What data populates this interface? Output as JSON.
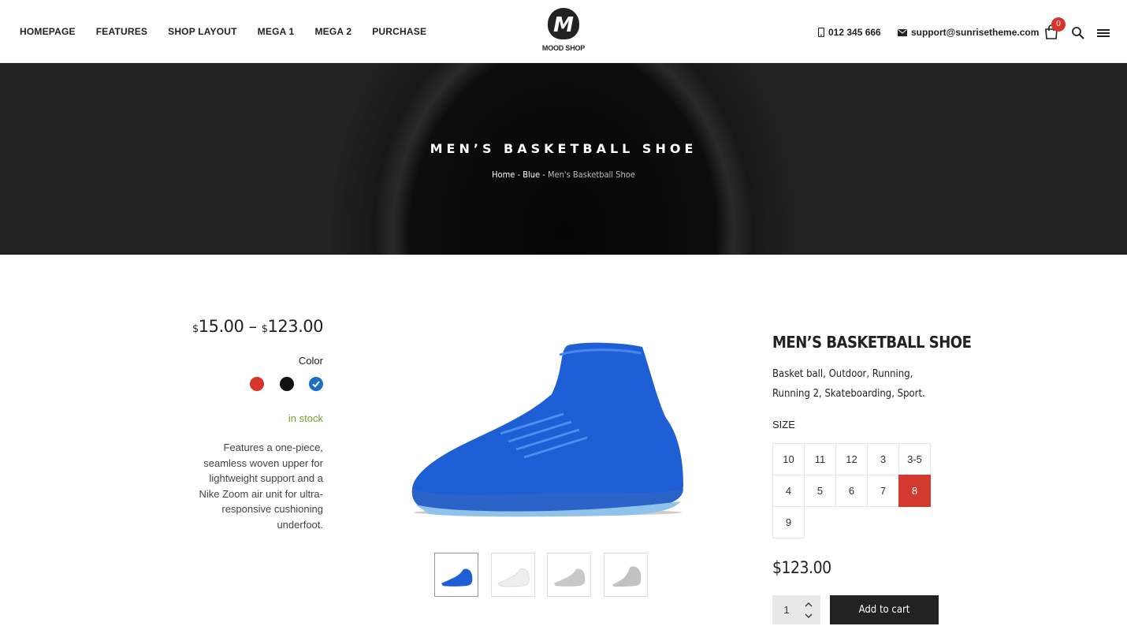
{
  "nav": {
    "items": [
      "HOMEPAGE",
      "FEATURES",
      "SHOP LAYOUT",
      "MEGA 1",
      "MEGA 2",
      "PURCHASE"
    ]
  },
  "logo": {
    "letter": "M",
    "name": "MOOD SHOP"
  },
  "header": {
    "phone": "012 345 666",
    "email": "support@sunrisetheme.com",
    "cart_count": "0",
    "icons": [
      "phone-icon",
      "mail-icon",
      "cart-icon",
      "search-icon",
      "menu-icon"
    ]
  },
  "hero": {
    "title": "MEN’S BASKETBALL SHOE",
    "breadcrumb": [
      "Home",
      "Blue",
      "Men's Basketball Shoe"
    ],
    "separator": " - "
  },
  "product": {
    "price_range": {
      "currency": "$",
      "min": "15.00",
      "max": "123.00",
      "dash": "–"
    },
    "color_label": "Color",
    "colors": [
      {
        "name": "red",
        "hex": "#d9342b",
        "selected": false
      },
      {
        "name": "black",
        "hex": "#111111",
        "selected": false
      },
      {
        "name": "blue",
        "hex": "#1e6fc4",
        "selected": true
      }
    ],
    "stock": "in stock",
    "description": "Features a one-piece, seamless woven upper for lightweight support and a Nike Zoom air unit for ultra-responsive cushioning underfoot.",
    "title": "MEN’S BASKETBALL SHOE",
    "tags": "Basket ball, Outdoor, Running, Running 2, Skateboarding, Sport.",
    "size_label": "SIZE",
    "sizes": [
      "10",
      "11",
      "12",
      "3",
      "3-5",
      "4",
      "5",
      "6",
      "7",
      "8",
      "9"
    ],
    "selected_size": "8",
    "price": "$123.00",
    "quantity": "1",
    "add_to_cart": "Add to cart",
    "thumbnails": [
      "blue",
      "white",
      "grey",
      "silver"
    ]
  },
  "colors": {
    "accent": "#d33a2f",
    "stock": "#77a12a",
    "dark": "#222222"
  }
}
